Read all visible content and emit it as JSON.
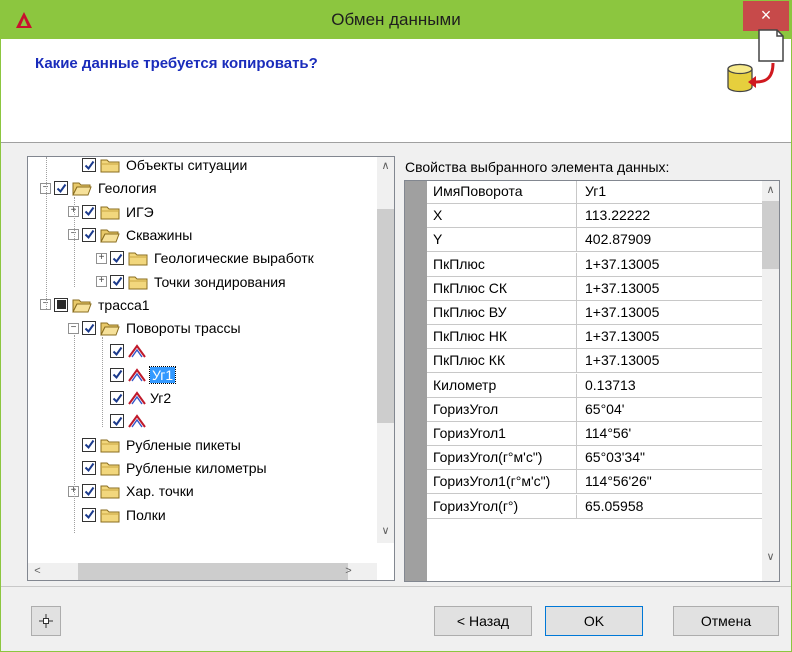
{
  "window": {
    "title": "Обмен данными",
    "close_glyph": "×",
    "app_icon": "autocad-triangle-icon",
    "accent_color": "#8cc63f",
    "close_color": "#c74a4a"
  },
  "header": {
    "question": "Какие данные требуется копировать?",
    "icon": "database-copy-icon",
    "question_color": "#1a2cbb"
  },
  "tree": {
    "nodes": [
      {
        "label": "Объекты ситуации",
        "expander": "",
        "check": "checked",
        "icon": "folder-icon"
      },
      {
        "label": "Геология",
        "expander": "−",
        "check": "checked",
        "icon": "folder-open-icon"
      },
      {
        "label": "ИГЭ",
        "expander": "+",
        "check": "checked",
        "icon": "folder-icon"
      },
      {
        "label": "Скважины",
        "expander": "−",
        "check": "checked",
        "icon": "folder-open-icon"
      },
      {
        "label": "Геологические выработк",
        "expander": "+",
        "check": "checked",
        "icon": "folder-icon"
      },
      {
        "label": "Точки зондирования",
        "expander": "+",
        "check": "checked",
        "icon": "folder-icon"
      },
      {
        "label": "трасса1",
        "expander": "−",
        "check": "partial",
        "icon": "folder-open-icon"
      },
      {
        "label": "Повороты трассы",
        "expander": "−",
        "check": "checked",
        "icon": "folder-open-icon"
      },
      {
        "label": "",
        "expander": "",
        "check": "checked",
        "icon": "turn-icon"
      },
      {
        "label": "Уг1",
        "expander": "",
        "check": "checked",
        "icon": "turn-icon",
        "selected": true
      },
      {
        "label": "Уг2",
        "expander": "",
        "check": "checked",
        "icon": "turn-icon"
      },
      {
        "label": "",
        "expander": "",
        "check": "checked",
        "icon": "turn-icon"
      },
      {
        "label": "Рубленые пикеты",
        "expander": "",
        "check": "checked",
        "icon": "folder-icon"
      },
      {
        "label": "Рубленые километры",
        "expander": "",
        "check": "checked",
        "icon": "folder-icon"
      },
      {
        "label": "Хар. точки",
        "expander": "+",
        "check": "checked",
        "icon": "folder-icon"
      },
      {
        "label": "Полки",
        "expander": "",
        "check": "checked",
        "icon": "folder-icon"
      }
    ],
    "scroll_up": "∧",
    "scroll_down": "∨",
    "scroll_left": "<",
    "scroll_right": ">"
  },
  "properties": {
    "caption": "Свойства выбранного элемента данных:",
    "rows": [
      {
        "key": "ИмяПоворота",
        "value": "Уг1"
      },
      {
        "key": "X",
        "value": "113.22222"
      },
      {
        "key": "Y",
        "value": "402.87909"
      },
      {
        "key": "ПкПлюс",
        "value": "1+37.13005"
      },
      {
        "key": "ПкПлюс СК",
        "value": "1+37.13005"
      },
      {
        "key": "ПкПлюс ВУ",
        "value": "1+37.13005"
      },
      {
        "key": "ПкПлюс НК",
        "value": "1+37.13005"
      },
      {
        "key": "ПкПлюс КК",
        "value": "1+37.13005"
      },
      {
        "key": "Километр",
        "value": "0.13713"
      },
      {
        "key": "ГоризУгол",
        "value": "65°04'"
      },
      {
        "key": "ГоризУгол1",
        "value": "114°56'"
      },
      {
        "key": "ГоризУгол(г°м'с\")",
        "value": "65°03'34\""
      },
      {
        "key": "ГоризУгол1(г°м'с\")",
        "value": "114°56'26\""
      },
      {
        "key": "ГоризУгол(г°)",
        "value": "65.05958"
      }
    ],
    "scroll_up": "∧",
    "scroll_down": "∨"
  },
  "footer": {
    "pin_icon": "crosshair-pin-icon",
    "back_label": "< Назад",
    "ok_label": "OK",
    "cancel_label": "Отмена"
  }
}
